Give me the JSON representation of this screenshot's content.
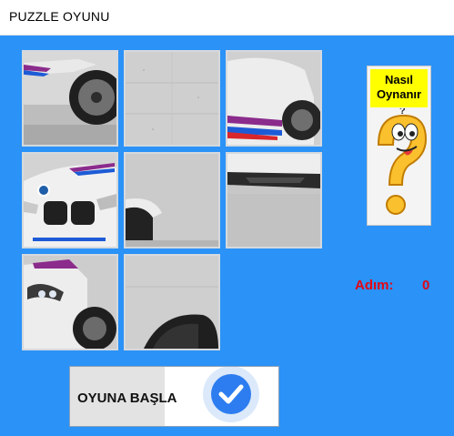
{
  "window": {
    "title": "PUZZLE OYUNU"
  },
  "help_panel": {
    "line1": "Nasıl",
    "line2": "Oynanır",
    "icon": "question-mark-character-icon"
  },
  "steps": {
    "label": "Adım:",
    "value": "0"
  },
  "start_button": {
    "label": "OYUNA BAŞLA",
    "icon": "checkmark-circle-icon"
  },
  "colors": {
    "background": "#2b92f7",
    "steps_text": "#e30613",
    "help_header": "#ffff00",
    "check_blue": "#2d7df0"
  },
  "puzzle": {
    "grid": "3x3",
    "tiles": [
      {
        "id": "tile-1",
        "content": "car-wheel-front"
      },
      {
        "id": "tile-2",
        "content": "concrete-wall"
      },
      {
        "id": "tile-3",
        "content": "car-side-door"
      },
      {
        "id": "tile-4",
        "content": "car-front-grille"
      },
      {
        "id": "tile-5",
        "content": "car-front-bumper"
      },
      {
        "id": "tile-6",
        "content": "car-rear-diffuser"
      },
      {
        "id": "tile-7",
        "content": "car-headlight"
      },
      {
        "id": "tile-8",
        "content": "car-wheel-dark"
      },
      {
        "id": "tile-9",
        "content": "empty"
      }
    ]
  }
}
